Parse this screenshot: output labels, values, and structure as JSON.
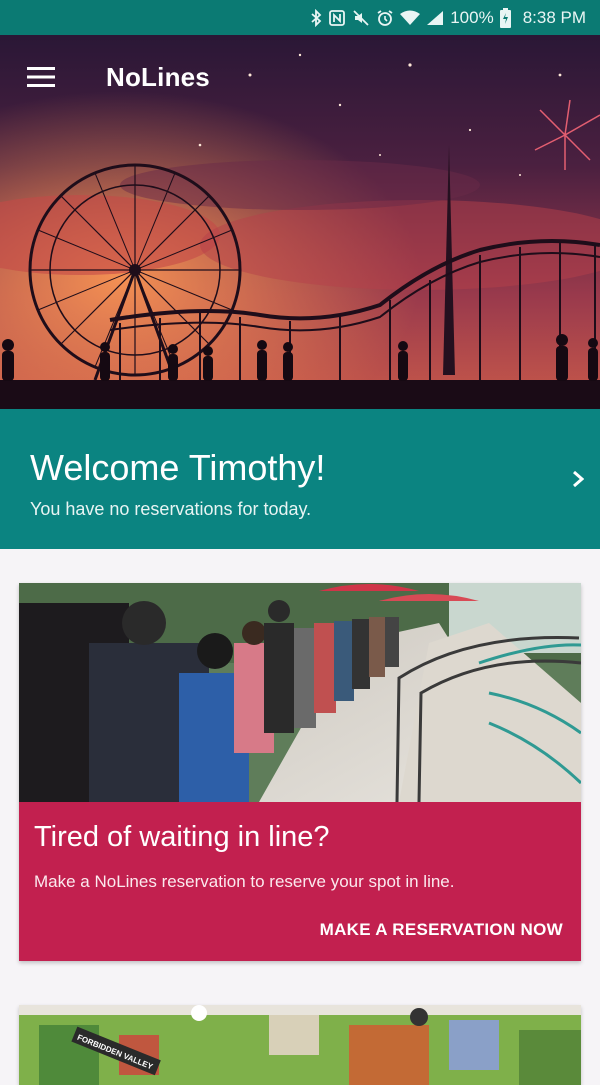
{
  "status_bar": {
    "battery": "100%",
    "time": "8:38 PM",
    "icons": [
      "bluetooth-icon",
      "nfc-icon",
      "mute-icon",
      "alarm-icon",
      "wifi-icon",
      "signal-icon",
      "battery-icon"
    ]
  },
  "app_bar": {
    "title": "NoLines",
    "menu_icon": "hamburger-menu-icon"
  },
  "welcome": {
    "title": "Welcome Timothy!",
    "subtitle": "You have no reservations for today.",
    "chevron_icon": "chevron-right-icon"
  },
  "card": {
    "title": "Tired of waiting in line?",
    "text": "Make a NoLines reservation to reserve your spot in line.",
    "action": "MAKE A RESERVATION NOW"
  },
  "map_card": {
    "sign": "FORBIDDEN VALLEY"
  },
  "colors": {
    "status_bar": "#0b7a73",
    "teal": "#0b8481",
    "card": "#c2204f",
    "background": "#f6f4f7"
  }
}
